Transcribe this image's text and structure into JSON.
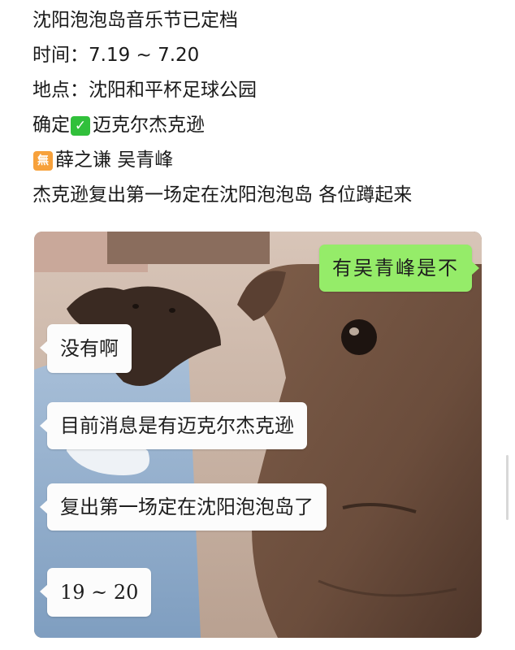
{
  "post": {
    "line1": "沈阳泡泡岛音乐节已定档",
    "line2": "时间：7.19 ~ 7.20",
    "line3": "地点：沈阳和平杯足球公园",
    "line4_prefix": "确定",
    "line4_check_icon": "✅",
    "line4_suffix": "迈克尔杰克逊",
    "line5_badge_text": "無",
    "line5_rest": "薛之谦 吴青峰",
    "line6": "杰克逊复出第一场定在沈阳泡泡岛 各位蹲起来"
  },
  "chat": {
    "sent": [
      {
        "text": "有吴青峰是不"
      }
    ],
    "received": [
      {
        "text": "没有啊"
      },
      {
        "text": "目前消息是有迈克尔杰克逊"
      },
      {
        "text": "复出第一场定在沈阳泡泡岛了"
      },
      {
        "text": "19 ~ 20"
      }
    ]
  },
  "colors": {
    "sent_bubble": "#95ec69",
    "received_bubble": "#fcfcfc",
    "check_badge": "#31c03b",
    "wu_badge": "#f7a13b"
  }
}
